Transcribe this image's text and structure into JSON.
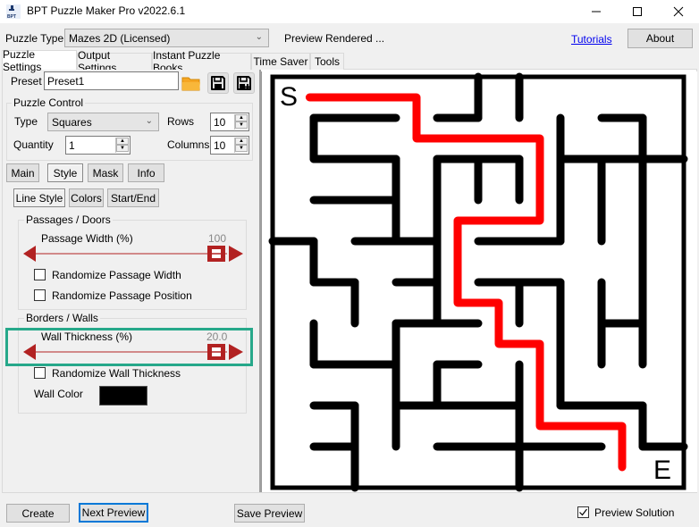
{
  "window": {
    "title": "BPT Puzzle Maker Pro v2022.6.1",
    "app_icon": "bpt-logo-icon",
    "controls": {
      "minimize": "—",
      "maximize": "☐",
      "close": "✕"
    }
  },
  "toolbar": {
    "puzzle_type_label": "Puzzle Type",
    "puzzle_type_value": "Mazes 2D (Licensed)",
    "status": "Preview Rendered ...",
    "tutorials_link": "Tutorials",
    "about_button": "About"
  },
  "tabs": [
    {
      "label": "Puzzle Settings",
      "active": true
    },
    {
      "label": "Output Settings",
      "active": false
    },
    {
      "label": "Instant Puzzle Books",
      "active": false
    },
    {
      "label": "Time Saver",
      "active": false
    },
    {
      "label": "Tools",
      "active": false
    }
  ],
  "preset": {
    "label": "Preset",
    "value": "Preset1",
    "icons": [
      "open-folder-icon",
      "save-icon",
      "save-as-icon"
    ]
  },
  "puzzle_control": {
    "title": "Puzzle Control",
    "type_label": "Type",
    "type_value": "Squares",
    "rows_label": "Rows",
    "rows_value": "10",
    "quantity_label": "Quantity",
    "quantity_value": "1",
    "columns_label": "Columns",
    "columns_value": "10"
  },
  "subtabs": [
    {
      "label": "Main",
      "active": false
    },
    {
      "label": "Style",
      "active": true
    },
    {
      "label": "Mask",
      "active": false
    },
    {
      "label": "Info",
      "active": false
    }
  ],
  "style_tabs": [
    {
      "label": "Line Style",
      "active": true
    },
    {
      "label": "Colors",
      "active": false
    },
    {
      "label": "Start/End",
      "active": false
    }
  ],
  "passages": {
    "title": "Passages / Doors",
    "width_label": "Passage Width (%)",
    "width_value": "100",
    "width_fraction": 1.0,
    "randomize_width": {
      "label": "Randomize Passage Width",
      "checked": false
    },
    "randomize_position": {
      "label": "Randomize Passage Position",
      "checked": false
    }
  },
  "walls": {
    "title": "Borders / Walls",
    "thickness_label": "Wall Thickness (%)",
    "thickness_value": "20.0",
    "thickness_fraction": 1.0,
    "randomize_thickness": {
      "label": "Randomize Wall Thickness",
      "checked": false
    },
    "color_label": "Wall Color",
    "color": "#000000"
  },
  "maze": {
    "rows": 10,
    "cols": 10,
    "start_label": "S",
    "end_label": "E",
    "wall_color": "#000000",
    "path_color": "#ff0000",
    "walls": [
      [
        1,
        1,
        3,
        1
      ],
      [
        1,
        1,
        1,
        2
      ],
      [
        1,
        2,
        3,
        2
      ],
      [
        3,
        2,
        3,
        4
      ],
      [
        1,
        3,
        3,
        3
      ],
      [
        4,
        1,
        5,
        1
      ],
      [
        5,
        0,
        5,
        1
      ],
      [
        6,
        0,
        6,
        1
      ],
      [
        7,
        1,
        7,
        4
      ],
      [
        8,
        1,
        9,
        1
      ],
      [
        9,
        1,
        9,
        7
      ],
      [
        7,
        2,
        10,
        2
      ],
      [
        4,
        2,
        6,
        2
      ],
      [
        4,
        2,
        4,
        6
      ],
      [
        5,
        2,
        5,
        3
      ],
      [
        6,
        2,
        6,
        3
      ],
      [
        8,
        2,
        8,
        4
      ],
      [
        0,
        4,
        1,
        4
      ],
      [
        1,
        4,
        1,
        5
      ],
      [
        2,
        4,
        4,
        4
      ],
      [
        5,
        4,
        7,
        4
      ],
      [
        1,
        5,
        2,
        5
      ],
      [
        3,
        5,
        4,
        5
      ],
      [
        5,
        5,
        7,
        5
      ],
      [
        2,
        5,
        2,
        6
      ],
      [
        3,
        6,
        5,
        6
      ],
      [
        6,
        5,
        6,
        6
      ],
      [
        7,
        5,
        7,
        8
      ],
      [
        8,
        5,
        8,
        7
      ],
      [
        8,
        6,
        9,
        6
      ],
      [
        1,
        6,
        1,
        7
      ],
      [
        1,
        7,
        3,
        7
      ],
      [
        3,
        6,
        3,
        9
      ],
      [
        4,
        7,
        5,
        7
      ],
      [
        4,
        7,
        4,
        8
      ],
      [
        3,
        8,
        6,
        8
      ],
      [
        6,
        7,
        6,
        10
      ],
      [
        7,
        8,
        9,
        8
      ],
      [
        9,
        8,
        9,
        9
      ],
      [
        9,
        9,
        10,
        9
      ],
      [
        1,
        8,
        2,
        8
      ],
      [
        2,
        8,
        2,
        10
      ],
      [
        1,
        9,
        2,
        9
      ],
      [
        4,
        9,
        8,
        9
      ]
    ],
    "solution_path": [
      [
        0.4,
        0
      ],
      [
        3,
        0
      ],
      [
        3,
        1
      ],
      [
        6,
        1
      ],
      [
        6,
        3
      ],
      [
        4,
        3
      ],
      [
        4,
        5
      ],
      [
        5,
        5
      ],
      [
        5,
        6
      ],
      [
        6,
        6
      ],
      [
        6,
        8
      ],
      [
        8,
        8
      ],
      [
        8,
        9
      ]
    ]
  },
  "footer": {
    "create_button": "Create",
    "next_preview_button": "Next Preview",
    "save_preview_button": "Save Preview",
    "preview_solution": {
      "label": "Preview Solution",
      "checked": true
    }
  },
  "colors": {
    "slider": "#b22222",
    "highlight": "#26a88a",
    "focus": "#0078d7"
  }
}
